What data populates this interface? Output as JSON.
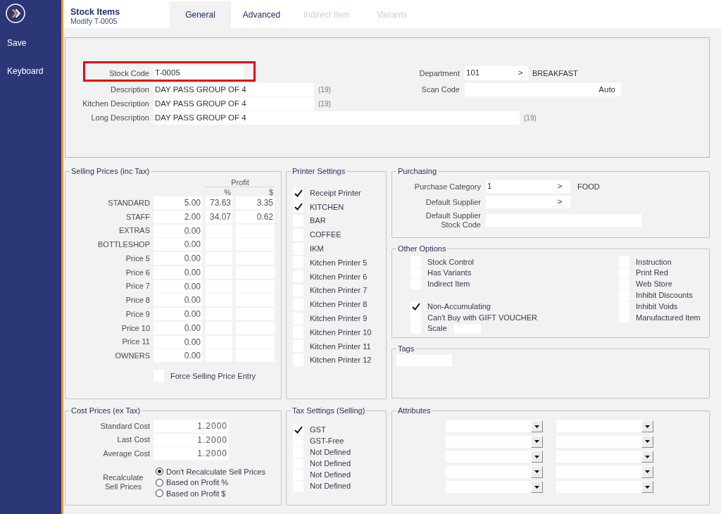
{
  "sidebar": {
    "items": [
      {
        "label": "Save"
      },
      {
        "label": "Keyboard"
      }
    ]
  },
  "header": {
    "title": "Stock Items",
    "subtitle": "Modify T-0005"
  },
  "tabs": [
    {
      "label": "General",
      "selected": true,
      "disabled": false
    },
    {
      "label": "Advanced",
      "selected": false,
      "disabled": false
    },
    {
      "label": "Indirect Item",
      "selected": false,
      "disabled": true
    },
    {
      "label": "Variants",
      "selected": false,
      "disabled": true
    }
  ],
  "top_panel": {
    "fields": [
      {
        "label": "Stock Code",
        "value": "T-0005",
        "highlighted": true
      },
      {
        "label": "Description",
        "value": "DAY PASS GROUP OF 4",
        "count": "(19)",
        "highlighted": false
      },
      {
        "label": "Kitchen Description",
        "value": "DAY PASS GROUP OF 4",
        "count": "(19)",
        "highlighted": false
      },
      {
        "label": "Long Description",
        "value": "DAY PASS GROUP OF 4",
        "count": "(19)",
        "highlighted": false
      }
    ],
    "department": {
      "label": "Department",
      "value": "101",
      "button": ">",
      "name": "BREAKFAST"
    },
    "scan_code": {
      "label": "Scan Code",
      "button": "Auto"
    }
  },
  "selling_prices": {
    "title": "Selling Prices (inc Tax)",
    "profit_header": "Profit",
    "columns": [
      "%",
      "$"
    ],
    "rows": [
      {
        "label": "STANDARD",
        "price": "5.00",
        "percent": "73.63",
        "amount": "3.35"
      },
      {
        "label": "STAFF",
        "price": "2.00",
        "percent": "34.07",
        "amount": "0.62"
      },
      {
        "label": "EXTRAS",
        "price": "0.00"
      },
      {
        "label": "BOTTLESHOP",
        "price": "0.00"
      },
      {
        "label": "Price 5",
        "price": "0.00"
      },
      {
        "label": "Price 6",
        "price": "0.00"
      },
      {
        "label": "Price 7",
        "price": "0.00"
      },
      {
        "label": "Price 8",
        "price": "0.00"
      },
      {
        "label": "Price 9",
        "price": "0.00"
      },
      {
        "label": "Price 10",
        "price": "0.00"
      },
      {
        "label": "Price 11",
        "price": "0.00"
      },
      {
        "label": "OWNERS",
        "price": "0.00"
      }
    ],
    "force_entry": {
      "label": "Force Selling Price Entry",
      "checked": false
    }
  },
  "printer_settings": {
    "title": "Printer Settings",
    "items": [
      {
        "label": "Receipt Printer",
        "checked": true
      },
      {
        "label": "KITCHEN",
        "checked": true
      },
      {
        "label": "BAR",
        "checked": false
      },
      {
        "label": "COFFEE",
        "checked": false
      },
      {
        "label": "IKM",
        "checked": false
      },
      {
        "label": "Kitchen Printer 5",
        "checked": false
      },
      {
        "label": "Kitchen Printer 6",
        "checked": false
      },
      {
        "label": "Kitchen Printer 7",
        "checked": false
      },
      {
        "label": "Kitchen Printer 8",
        "checked": false
      },
      {
        "label": "Kitchen Printer 9",
        "checked": false
      },
      {
        "label": "Kitchen Printer 10",
        "checked": false
      },
      {
        "label": "Kitchen Printer 11",
        "checked": false
      },
      {
        "label": "Kitchen Printer 12",
        "checked": false
      }
    ]
  },
  "purchasing": {
    "title": "Purchasing",
    "fields": [
      {
        "kind": "lookup",
        "label": "Purchase Category",
        "value": "1",
        "button": ">",
        "name": "FOOD"
      },
      {
        "kind": "lookup",
        "label": "Default Supplier",
        "button": ">"
      },
      {
        "kind": "text",
        "label": "Default Supplier Stock Code"
      }
    ]
  },
  "other_options": {
    "title": "Other Options",
    "left_groups": [
      {
        "items": [
          {
            "kind": "checkbox",
            "label": "Stock Control",
            "checked": false
          },
          {
            "kind": "checkbox",
            "label": "Has Variants",
            "checked": false
          },
          {
            "kind": "checkbox",
            "label": "Indirect Item",
            "checked": false
          }
        ]
      },
      {
        "items": [
          {
            "kind": "checkbox",
            "label": "Non-Accumulating",
            "checked": true
          },
          {
            "kind": "checkbox",
            "label": "Can't Buy with GIFT VOUCHER",
            "checked": false
          },
          {
            "kind": "checkbox_field",
            "label": "Scale",
            "checked": false
          }
        ]
      }
    ],
    "right_items": [
      {
        "label": "Instruction",
        "checked": false
      },
      {
        "label": "Print Red",
        "checked": false
      },
      {
        "label": "Web Store",
        "checked": false
      },
      {
        "label": "Inhibit Discounts",
        "checked": false
      },
      {
        "label": "Inhibit Voids",
        "checked": false
      },
      {
        "label": "Manufactured Item",
        "checked": false
      }
    ]
  },
  "tags": {
    "title": "Tags"
  },
  "cost_prices": {
    "title": "Cost Prices (ex Tax)",
    "rows": [
      {
        "label": "Standard Cost",
        "value": "1.2000"
      },
      {
        "label": "Last Cost",
        "value": "1.2000"
      },
      {
        "label": "Average Cost",
        "value": "1.2000"
      }
    ],
    "recalculate": {
      "label": "Recalculate Sell Prices",
      "options": [
        {
          "label": "Don't Recalculate Sell Prices",
          "selected": true
        },
        {
          "label": "Based on Profit %",
          "selected": false
        },
        {
          "label": "Based on Profit $",
          "selected": false
        }
      ]
    }
  },
  "tax_settings": {
    "title": "Tax Settings (Selling)",
    "items": [
      {
        "label": "GST",
        "checked": true
      },
      {
        "label": "GST-Free",
        "checked": false
      },
      {
        "label": "Not Defined",
        "checked": false
      },
      {
        "label": "Not Defined",
        "checked": false
      },
      {
        "label": "Not Defined",
        "checked": false
      },
      {
        "label": "Not Defined",
        "checked": false
      }
    ]
  },
  "attributes": {
    "title": "Attributes"
  }
}
